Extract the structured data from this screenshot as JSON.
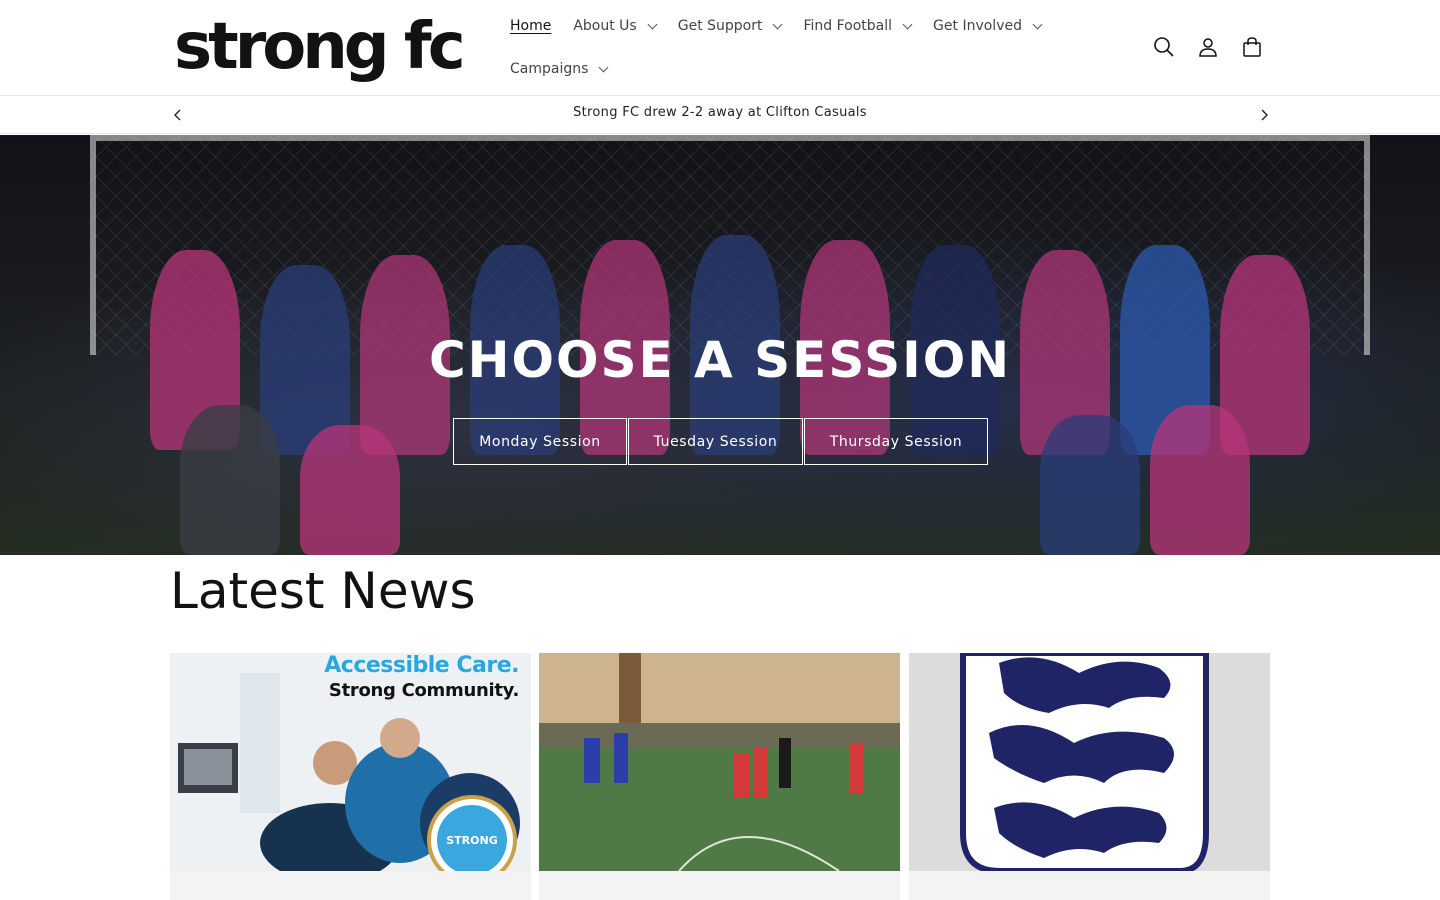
{
  "brand": {
    "logo_text": "strong fc"
  },
  "nav": {
    "items": [
      {
        "label": "Home",
        "active": true,
        "has_dropdown": false
      },
      {
        "label": "About Us",
        "active": false,
        "has_dropdown": true
      },
      {
        "label": "Get Support",
        "active": false,
        "has_dropdown": true
      },
      {
        "label": "Find Football",
        "active": false,
        "has_dropdown": true
      },
      {
        "label": "Get Involved",
        "active": false,
        "has_dropdown": true
      },
      {
        "label": "Campaigns",
        "active": false,
        "has_dropdown": true
      }
    ]
  },
  "header_icons": [
    "search-icon",
    "account-icon",
    "cart-icon"
  ],
  "announcement": {
    "text": "Strong FC drew 2-2 away at Clifton Casuals"
  },
  "hero": {
    "title": "CHOOSE A SESSION",
    "buttons": [
      "Monday Session",
      "Tuesday Session",
      "Thursday Session"
    ]
  },
  "news": {
    "title": "Latest News",
    "cards": [
      {
        "headline_1": "Accessible Care.",
        "headline_2": "Strong Community.",
        "badge": "STRONG"
      },
      {},
      {}
    ]
  },
  "colors": {
    "text": "#121212",
    "accent_blue": "#2aa6e0",
    "england_navy": "#1f2466",
    "card_bg": "#f3f3f3"
  }
}
